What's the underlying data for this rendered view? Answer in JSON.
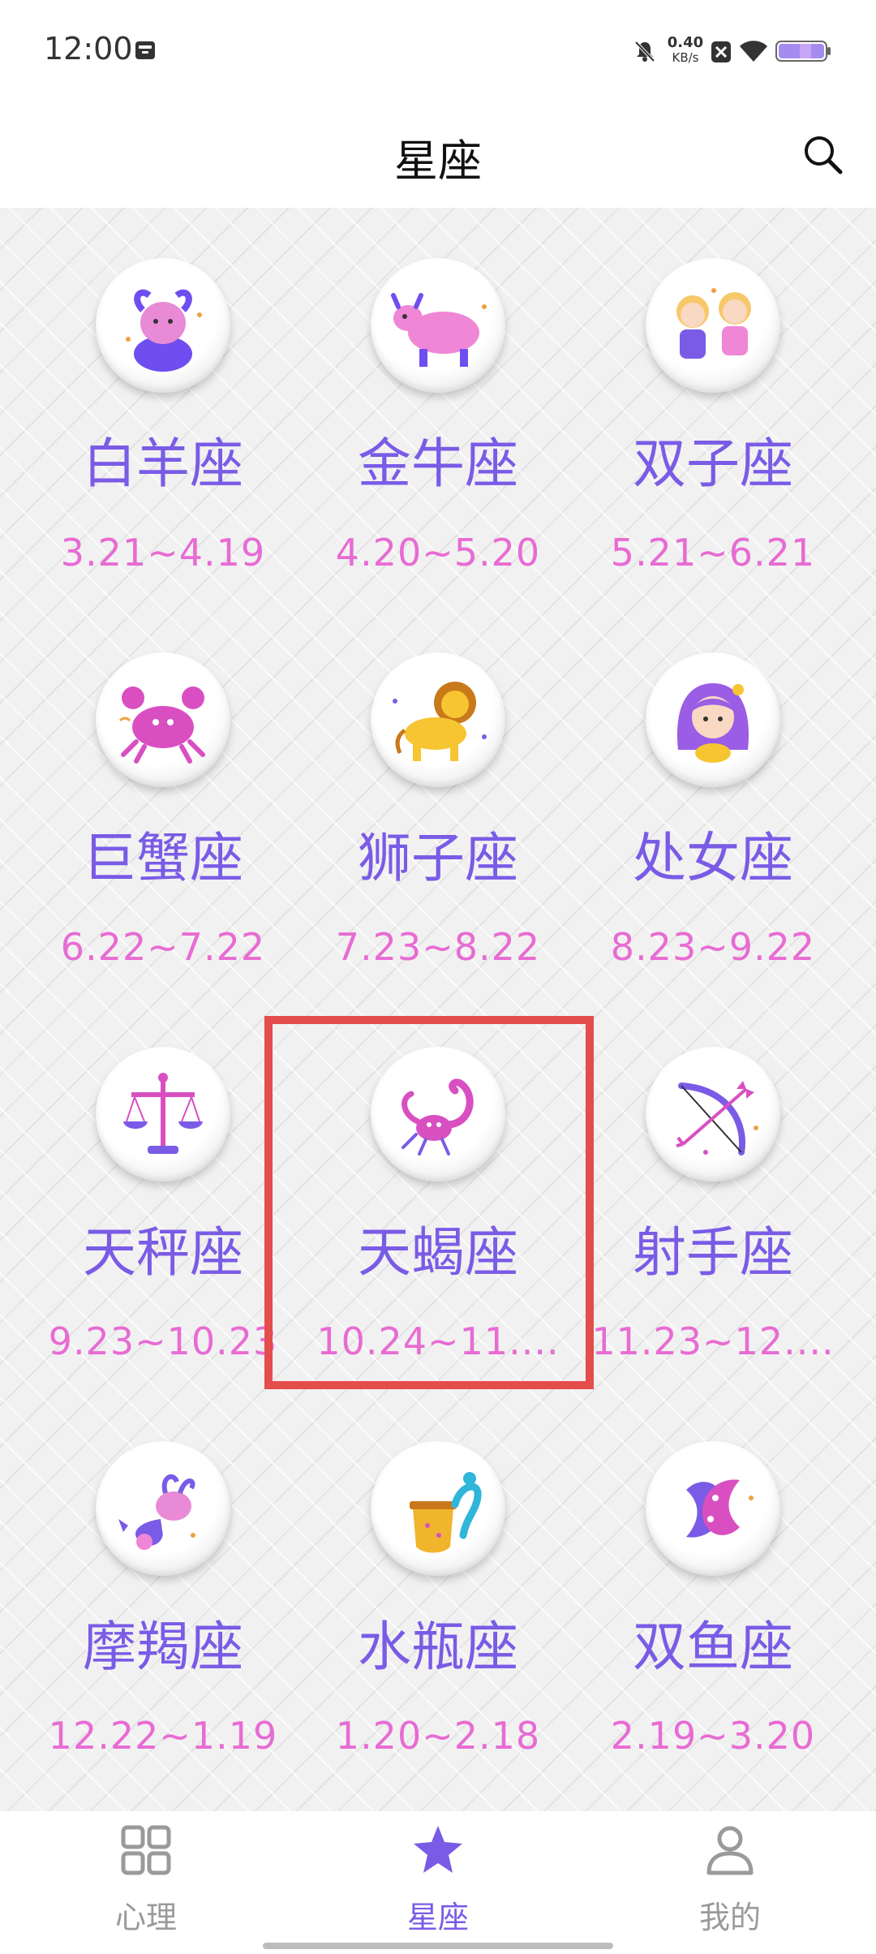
{
  "status_bar": {
    "time": "12:00",
    "net_speed_value": "0.40",
    "net_speed_unit": "KB/s",
    "icons": [
      "storage-icon",
      "mute-icon",
      "no-sim-icon",
      "wifi-icon",
      "battery-icon"
    ]
  },
  "header": {
    "title": "星座",
    "search_icon": "search-icon"
  },
  "zodiacs": [
    {
      "name": "白羊座",
      "dates": "3.21~4.19",
      "icon": "aries-icon"
    },
    {
      "name": "金牛座",
      "dates": "4.20~5.20",
      "icon": "taurus-icon"
    },
    {
      "name": "双子座",
      "dates": "5.21~6.21",
      "icon": "gemini-icon"
    },
    {
      "name": "巨蟹座",
      "dates": "6.22~7.22",
      "icon": "cancer-icon"
    },
    {
      "name": "狮子座",
      "dates": "7.23~8.22",
      "icon": "leo-icon"
    },
    {
      "name": "处女座",
      "dates": "8.23~9.22",
      "icon": "virgo-icon"
    },
    {
      "name": "天秤座",
      "dates": "9.23~10.23",
      "icon": "libra-icon"
    },
    {
      "name": "天蝎座",
      "dates": "10.24~11....",
      "icon": "scorpio-icon"
    },
    {
      "name": "射手座",
      "dates": "11.23~12....",
      "icon": "sagittarius-icon"
    },
    {
      "name": "摩羯座",
      "dates": "12.22~1.19",
      "icon": "capricorn-icon"
    },
    {
      "name": "水瓶座",
      "dates": "1.20~2.18",
      "icon": "aquarius-icon"
    },
    {
      "name": "双鱼座",
      "dates": "2.19~3.20",
      "icon": "pisces-icon"
    }
  ],
  "bottom_nav": {
    "items": [
      {
        "label": "心理",
        "icon": "grid-icon",
        "active": false
      },
      {
        "label": "星座",
        "icon": "star-icon",
        "active": true
      },
      {
        "label": "我的",
        "icon": "person-icon",
        "active": false
      }
    ]
  },
  "colors": {
    "name": "#7a5be6",
    "date": "#e86bd3",
    "accent": "#7a5be6",
    "nav_inactive": "#9a9a9a",
    "highlight": "#e54c4c"
  }
}
